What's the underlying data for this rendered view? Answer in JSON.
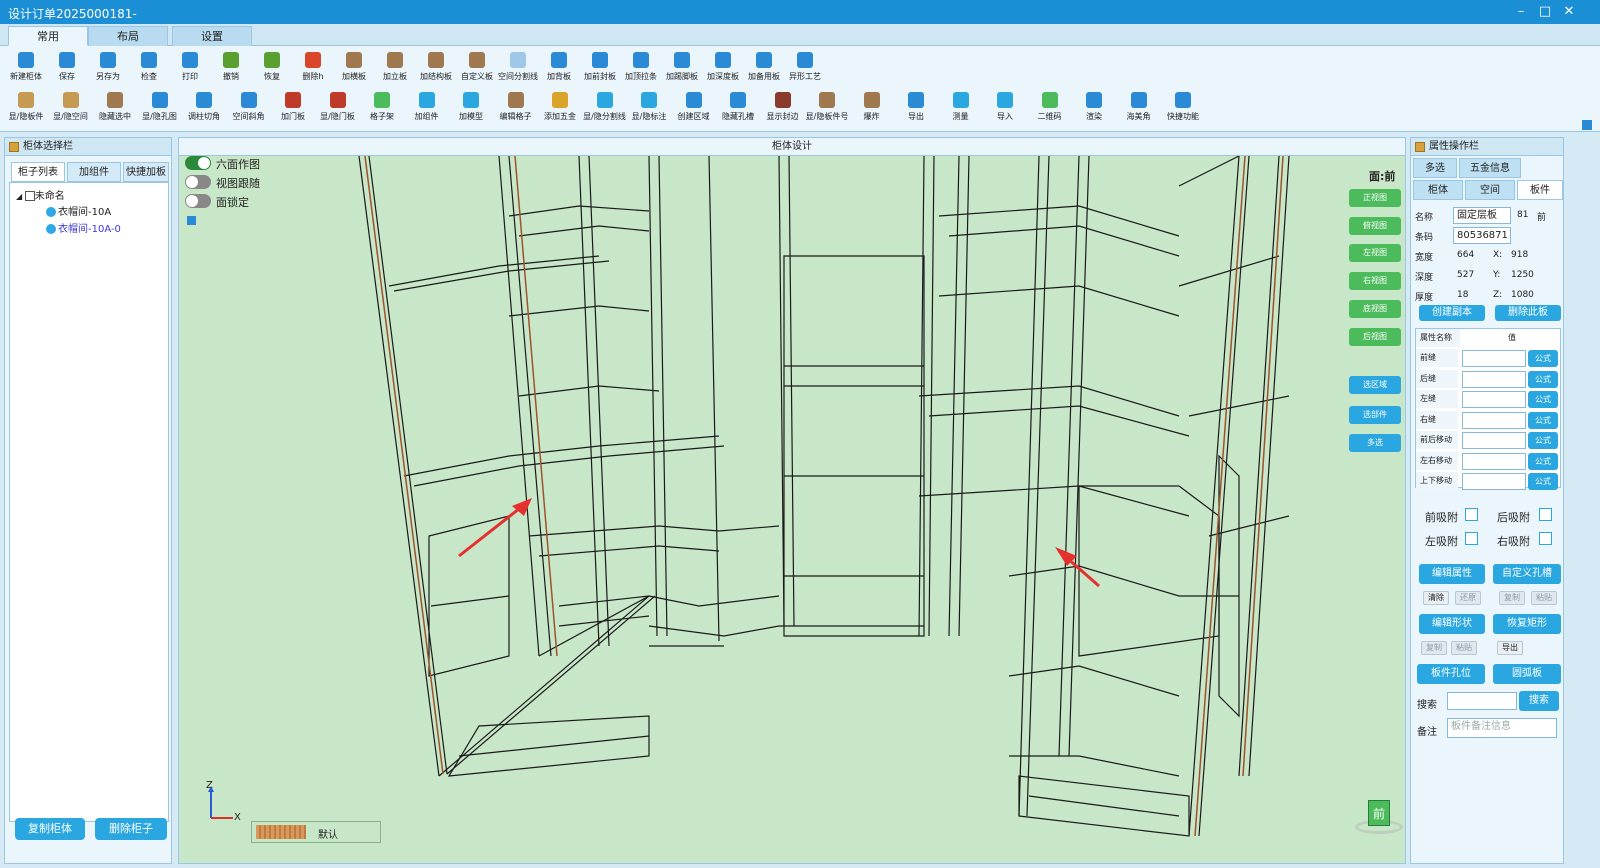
{
  "window": {
    "title": "设计订单2025000181-"
  },
  "ribbon_tabs": [
    {
      "label": "常用"
    },
    {
      "label": "布局"
    },
    {
      "label": "设置"
    }
  ],
  "toolbar_row1": [
    {
      "label": "新建柜体",
      "color": "#2a8ad6"
    },
    {
      "label": "保存",
      "color": "#2a8ad6"
    },
    {
      "label": "另存为",
      "color": "#2a8ad6"
    },
    {
      "label": "检查",
      "color": "#2a8ad6"
    },
    {
      "label": "打印",
      "color": "#2a8ad6"
    },
    {
      "label": "撤销",
      "color": "#5aa030"
    },
    {
      "label": "恢复",
      "color": "#5aa030"
    },
    {
      "label": "删除h",
      "color": "#d9462a"
    },
    {
      "label": "加横板",
      "color": "#a07850"
    },
    {
      "label": "加立板",
      "color": "#a07850"
    },
    {
      "label": "加结构板",
      "color": "#a07850"
    },
    {
      "label": "自定义板",
      "color": "#a07850"
    },
    {
      "label": "空间分割线",
      "color": "#9ec7e8"
    },
    {
      "label": "加背板",
      "color": "#2a8ad6"
    },
    {
      "label": "加前封板",
      "color": "#2a8ad6"
    },
    {
      "label": "加顶拉条",
      "color": "#2a8ad6"
    },
    {
      "label": "加踢脚板",
      "color": "#2a8ad6"
    },
    {
      "label": "加深度板",
      "color": "#2a8ad6"
    },
    {
      "label": "加备用板",
      "color": "#2a8ad6"
    },
    {
      "label": "异形工艺",
      "color": "#2a8ad6"
    }
  ],
  "toolbar_row2": [
    {
      "label": "显/隐板件",
      "color": "#c69a52"
    },
    {
      "label": "显/隐空间",
      "color": "#c69a52"
    },
    {
      "label": "隐藏选中",
      "color": "#a07850"
    },
    {
      "label": "显/隐孔图",
      "color": "#2a8ad6"
    },
    {
      "label": "调柱切角",
      "color": "#2a8ad6"
    },
    {
      "label": "空间斜角",
      "color": "#2a8ad6"
    },
    {
      "label": "加门板",
      "color": "#c03a2a"
    },
    {
      "label": "显/隐门板",
      "color": "#c03a2a"
    },
    {
      "label": "格子架",
      "color": "#4cbb5c"
    },
    {
      "label": "加组件",
      "color": "#2aa7e0"
    },
    {
      "label": "加模型",
      "color": "#2aa7e0"
    },
    {
      "label": "编辑格子",
      "color": "#a07850"
    },
    {
      "label": "添加五金",
      "color": "#d9a32a"
    },
    {
      "label": "显/隐分割线",
      "color": "#2aa7e0"
    },
    {
      "label": "显/隐标注",
      "color": "#2aa7e0"
    },
    {
      "label": "创建区域",
      "color": "#2a8ad6"
    },
    {
      "label": "隐藏孔槽",
      "color": "#2a8ad6"
    },
    {
      "label": "显示封边",
      "color": "#8a3a2a"
    },
    {
      "label": "显/隐板件号",
      "color": "#a07850"
    },
    {
      "label": "爆炸",
      "color": "#a07850"
    },
    {
      "label": "导出",
      "color": "#2a8ad6"
    },
    {
      "label": "测量",
      "color": "#2aa7e0"
    },
    {
      "label": "导入",
      "color": "#2aa7e0"
    },
    {
      "label": "二维码",
      "color": "#4cbb5c"
    },
    {
      "label": "渲染",
      "color": "#2a8ad6"
    },
    {
      "label": "海美角",
      "color": "#2a8ad6"
    },
    {
      "label": "快捷功能",
      "color": "#2a8ad6"
    }
  ],
  "left_panel": {
    "title": "柜体选择栏",
    "tabs": [
      {
        "label": "柜子列表"
      },
      {
        "label": "加组件"
      },
      {
        "label": "快捷加板"
      }
    ],
    "tree": {
      "root": "未命名",
      "children": [
        {
          "label": "衣帽间-10A"
        },
        {
          "label": "衣帽间-10A-0"
        }
      ]
    },
    "copy_button": "复制柜体",
    "delete_button": "删除柜子"
  },
  "design": {
    "title": "柜体设计",
    "toggles": [
      {
        "label": "六面作图",
        "on": true
      },
      {
        "label": "视图跟随",
        "on": false
      },
      {
        "label": "面锁定",
        "on": false
      }
    ],
    "face_label": "面:前",
    "view_buttons": [
      "正视图",
      "俯视图",
      "左视图",
      "右视图",
      "底视图",
      "后视图"
    ],
    "select_buttons": [
      "选区域",
      "选部件",
      "多选"
    ],
    "material_label": "默认",
    "axis_x": "X",
    "axis_z": "Z",
    "cube_label": "前"
  },
  "right_panel": {
    "title": "属性操作栏",
    "tabs_row1": [
      {
        "label": "多选"
      },
      {
        "label": "五金信息"
      }
    ],
    "tabs_row2": [
      {
        "label": "柜体"
      },
      {
        "label": "空间"
      },
      {
        "label": "板件"
      }
    ],
    "name_label": "名称",
    "name_value": "固定层板",
    "name_suffix1": "81",
    "name_suffix2": "前",
    "code_label": "条码",
    "code_value": "80536871",
    "width_label": "宽度",
    "width_value": "664",
    "x_label": "X:",
    "x_value": "918",
    "depth_label": "深度",
    "depth_value": "527",
    "y_label": "Y:",
    "y_value": "1250",
    "thick_label": "厚度",
    "thick_value": "18",
    "z_label": "Z:",
    "z_value": "1080",
    "create_copy": "创建副本",
    "delete_board": "删除此板",
    "attr_header_name": "属性名称",
    "attr_header_value": "值",
    "attrs": [
      {
        "name": "前缝",
        "btn": "公式"
      },
      {
        "name": "后缝",
        "btn": "公式"
      },
      {
        "name": "左缝",
        "btn": "公式"
      },
      {
        "name": "右缝",
        "btn": "公式"
      },
      {
        "name": "前后移动",
        "btn": "公式"
      },
      {
        "name": "左右移动",
        "btn": "公式"
      },
      {
        "name": "上下移动",
        "btn": "公式"
      }
    ],
    "front_attach": "前吸附",
    "back_attach": "后吸附",
    "left_attach": "左吸附",
    "right_attach": "右吸附",
    "edit_attr": "编辑属性",
    "custom_slot": "自定义孔槽",
    "small1": [
      "清除",
      "还原",
      "复制",
      "粘贴"
    ],
    "edit_shape": "编辑形状",
    "restore_rect": "恢复矩形",
    "small2": [
      "复制",
      "粘贴",
      "导出"
    ],
    "board_holes": "板件孔位",
    "arc_board": "圆弧板",
    "search_label": "搜索",
    "search_button": "搜索",
    "note_label": "备注",
    "note_placeholder": "板件备注信息"
  }
}
